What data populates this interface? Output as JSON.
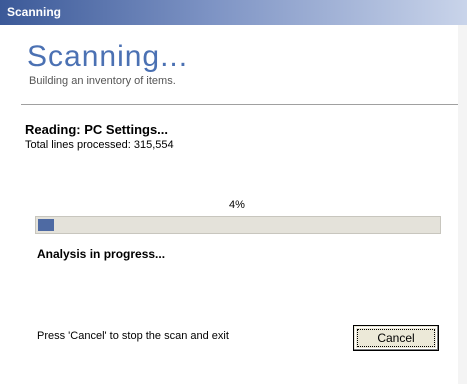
{
  "window": {
    "title": "Scanning"
  },
  "header": {
    "title": "Scanning...",
    "subtitle": "Building an inventory of items."
  },
  "status": {
    "reading": "Reading: PC Settings...",
    "lines_processed": "Total lines processed: 315,554"
  },
  "progress": {
    "percent_label": "4%",
    "value": 0.04
  },
  "analysis": {
    "label": "Analysis in progress..."
  },
  "footer": {
    "hint": "Press 'Cancel' to stop the scan and exit",
    "cancel_label": "Cancel"
  },
  "colors": {
    "title_accent": "#4b71b3",
    "progress_fill": "#4e6aa3",
    "titlebar_start": "#3b5998"
  }
}
